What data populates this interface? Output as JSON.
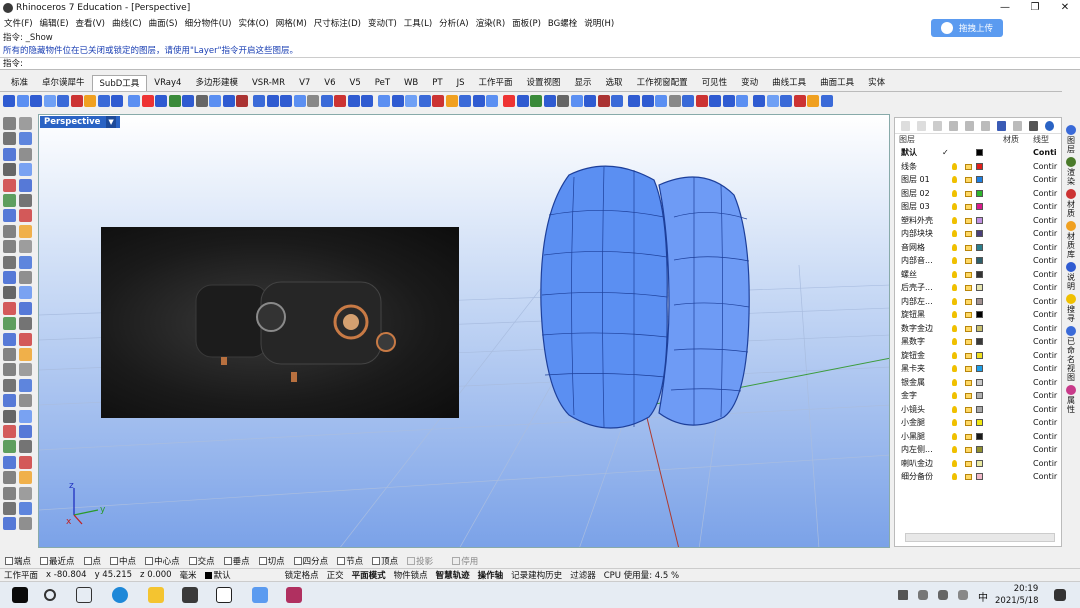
{
  "window": {
    "title": "Rhinoceros 7 Education - [Perspective]"
  },
  "menu": [
    "文件(F)",
    "编辑(E)",
    "查看(V)",
    "曲线(C)",
    "曲面(S)",
    "细分物件(U)",
    "实体(O)",
    "网格(M)",
    "尺寸标注(D)",
    "变动(T)",
    "工具(L)",
    "分析(A)",
    "渲染(R)",
    "面板(P)",
    "BG螺栓",
    "说明(H)"
  ],
  "command_history": {
    "line1": "指令: _Show",
    "line2": "所有的隐藏物件位在已关闭或锁定的图层，请使用\"Layer\"指令开启这些图层。"
  },
  "upload_button": "拖拽上传",
  "command_prompt": "指令:",
  "tabs": [
    "标准",
    "卓尔谟犀牛",
    "SubD工具",
    "VRay4",
    "多边形建模",
    "VSR-MR",
    "V7",
    "V6",
    "V5",
    "PeT",
    "WB",
    "PT",
    "JS",
    "工作平面",
    "设置视图",
    "显示",
    "选取",
    "工作视窗配置",
    "可见性",
    "变动",
    "曲线工具",
    "曲面工具",
    "实体"
  ],
  "active_tab": "SubD工具",
  "viewport": {
    "label": "Perspective"
  },
  "layers_panel": {
    "header": {
      "layer": "图层",
      "material": "材质",
      "linetype": "线型"
    },
    "layers": [
      {
        "name": "默认",
        "color": "#000000",
        "linetype": "Conti",
        "current": true
      },
      {
        "name": "线条",
        "color": "#e0201c",
        "linetype": "Contir"
      },
      {
        "name": "图层 01",
        "color": "#1e7fe0",
        "linetype": "Contir"
      },
      {
        "name": "图层 02",
        "color": "#2db52d",
        "linetype": "Contir"
      },
      {
        "name": "图层 03",
        "color": "#d81c8a",
        "linetype": "Contir"
      },
      {
        "name": "塑料外壳",
        "color": "#c090e0",
        "linetype": "Contir"
      },
      {
        "name": "内部块块",
        "color": "#4a3f7a",
        "linetype": "Contir"
      },
      {
        "name": "音网格",
        "color": "#2c7f8c",
        "linetype": "Contir"
      },
      {
        "name": "内部音...",
        "color": "#2f5f6a",
        "linetype": "Contir"
      },
      {
        "name": "螺丝",
        "color": "#333333",
        "linetype": "Contir"
      },
      {
        "name": "后壳子...",
        "color": "#e6e6b0",
        "linetype": "Contir"
      },
      {
        "name": "内部左...",
        "color": "#a09090",
        "linetype": "Contir"
      },
      {
        "name": "旋钮黑",
        "color": "#000000",
        "linetype": "Contir"
      },
      {
        "name": "数字金边",
        "color": "#c8c070",
        "linetype": "Contir"
      },
      {
        "name": "黑数字",
        "color": "#3a3a3a",
        "linetype": "Contir"
      },
      {
        "name": "旋钮金",
        "color": "#f0e020",
        "linetype": "Contir"
      },
      {
        "name": "黑卡夹",
        "color": "#1e9fe8",
        "linetype": "Contir"
      },
      {
        "name": "银金属",
        "color": "#c8c8c8",
        "linetype": "Contir"
      },
      {
        "name": "金字",
        "color": "#b0b0b0",
        "linetype": "Contir"
      },
      {
        "name": "小镜头",
        "color": "#a8a8a8",
        "linetype": "Contir"
      },
      {
        "name": "小金腿",
        "color": "#f0e810",
        "linetype": "Contir"
      },
      {
        "name": "小黑腿",
        "color": "#1a1a1a",
        "linetype": "Contir"
      },
      {
        "name": "内左侧...",
        "color": "#909030",
        "linetype": "Contir"
      },
      {
        "name": "喇叭金边",
        "color": "#e8e8a0",
        "linetype": "Contir"
      },
      {
        "name": "细分备份",
        "color": "#f0b8c8",
        "linetype": "Contir"
      }
    ]
  },
  "side_tabs": [
    "图层",
    "渲染",
    "材质",
    "材质库",
    "说明",
    "搜寻",
    "已命名视图",
    "属性"
  ],
  "osnaps": [
    "端点",
    "最近点",
    "点",
    "中点",
    "中心点",
    "交点",
    "垂点",
    "切点",
    "四分点",
    "节点",
    "顶点",
    "投影",
    "停用"
  ],
  "status": {
    "cplane": "工作平面",
    "x": "x -80.804",
    "y": "y 45.215",
    "z": "z 0.000",
    "unit": "毫米",
    "layer": "默认",
    "grid_snap": "锁定格点",
    "ortho": "正交",
    "planar": "平面模式",
    "osnap": "物件锁点",
    "smarttrack": "智慧轨迹",
    "gumball": "操作轴",
    "history": "记录建构历史",
    "filter": "过滤器",
    "cpu": "CPU 使用量: 4.5 %"
  },
  "taskbar": {
    "time": "20:19",
    "date": "2021/5/18",
    "ime": "中"
  }
}
